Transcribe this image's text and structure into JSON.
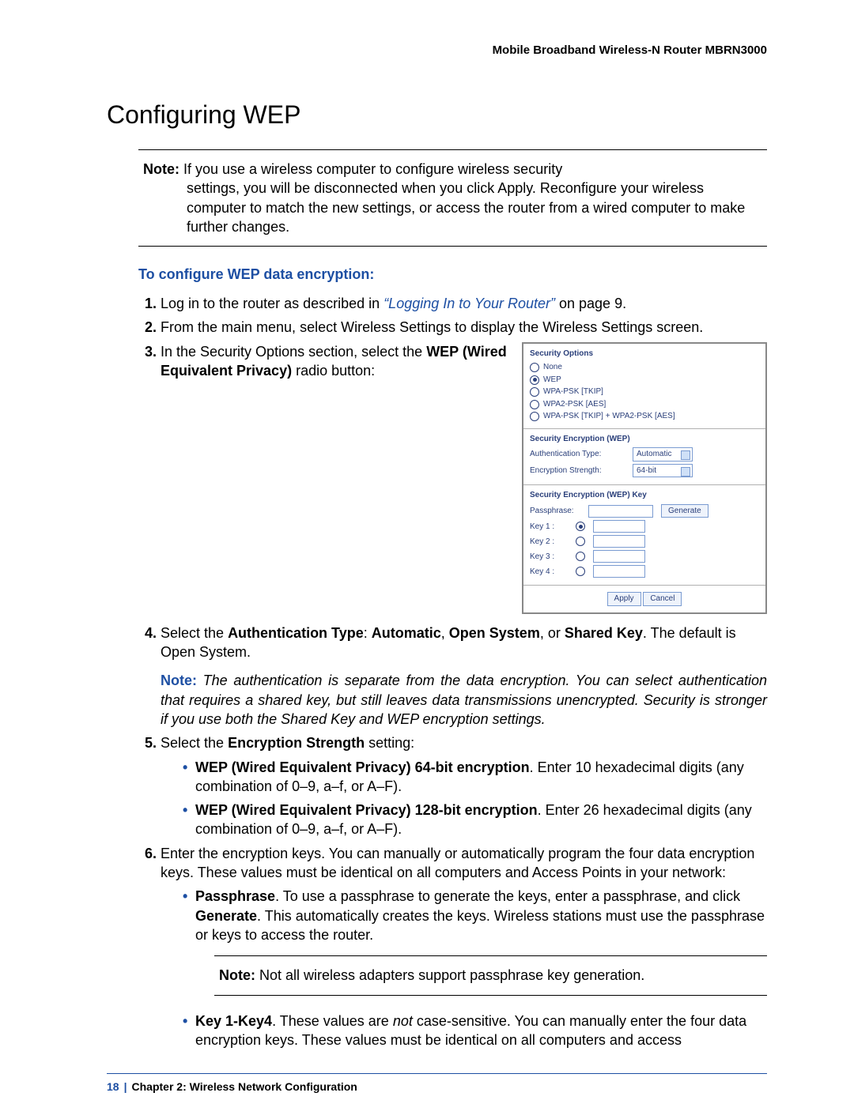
{
  "header": {
    "product": "Mobile Broadband Wireless-N Router MBRN3000"
  },
  "title": "Configuring WEP",
  "note_top": {
    "label": "Note:",
    "line1_after_label": "  If you use a wireless computer to configure wireless security",
    "rest": "settings, you will be disconnected when you click Apply. Reconfigure your wireless computer to match the new settings, or access the router from a wired computer to make further changes."
  },
  "subhead": "To configure WEP data encryption:",
  "steps": {
    "s1_a": "Log in to the router as described in ",
    "s1_link": "“Logging In to Your Router”",
    "s1_b": " on page 9.",
    "s2": "From the main menu, select Wireless Settings to display the Wireless Settings screen.",
    "s3_a": "In the Security Options section, select the ",
    "s3_b": "WEP (Wired Equivalent Privacy)",
    "s3_c": " radio button:",
    "s4_a": "Select the ",
    "s4_b": "Authentication Type",
    "s4_c": ": ",
    "s4_d": "Automatic",
    "s4_e": ", ",
    "s4_f": "Open System",
    "s4_g": ", or ",
    "s4_h": "Shared Key",
    "s4_i": ". The default is Open System.",
    "s4_note_label": "Note:",
    "s4_note_body": "  The authentication is separate from the data encryption. You can select authentication that requires a shared key, but still leaves data transmissions unencrypted. Security is stronger if you use both the Shared Key and WEP encryption settings.",
    "s5_a": "Select the ",
    "s5_b": "Encryption Strength",
    "s5_c": " setting:",
    "s5_bullet1_b1": "WEP (Wired Equivalent Privacy) 64-bit encryption",
    "s5_bullet1_rest": ". Enter 10 hexadecimal digits (any combination of 0–9, a–f, or A–F).",
    "s5_bullet2_b": "WEP (Wired Equivalent Privacy) 128-bit encryption",
    "s5_bullet2_rest": ". Enter 26 hexadecimal digits (any combination of 0–9, a–f, or A–F).",
    "s6_intro": "Enter the encryption keys. You can manually or automatically program the four data encryption keys. These values must be identical on all computers and Access Points in your network:",
    "s6_b1_b": "Passphrase",
    "s6_b1_rest_a": ". To use a passphrase to generate the keys, enter a passphrase, and click ",
    "s6_b1_rest_btn": "Generate",
    "s6_b1_rest_b": ". This automatically creates the keys. Wireless stations must use the passphrase or keys to access the router.",
    "s6_note_label": "Note:",
    "s6_note_body": "  Not all wireless adapters support passphrase key generation.",
    "s6_b2_b": "Key 1-Key4",
    "s6_b2_rest_a": ". These values are ",
    "s6_b2_not": "not",
    "s6_b2_rest_b": " case-sensitive. You can manually enter the four data encryption keys. These values must be identical on all computers and access"
  },
  "panel": {
    "sec_options_title": "Security Options",
    "opts": [
      "None",
      "WEP",
      "WPA-PSK [TKIP]",
      "WPA2-PSK [AES]",
      "WPA-PSK [TKIP] + WPA2-PSK [AES]"
    ],
    "selected_index": 1,
    "enc_title": "Security Encryption (WEP)",
    "auth_label": "Authentication Type:",
    "auth_value": "Automatic",
    "str_label": "Encryption Strength:",
    "str_value": "64-bit",
    "key_title": "Security Encryption (WEP) Key",
    "pass_label": "Passphrase:",
    "generate": "Generate",
    "k1": "Key 1 :",
    "k2": "Key 2 :",
    "k3": "Key 3 :",
    "k4": "Key 4 :",
    "apply": "Apply",
    "cancel": "Cancel"
  },
  "footer": {
    "page_no": "18",
    "chapter": "Chapter 2:  Wireless Network Configuration"
  }
}
